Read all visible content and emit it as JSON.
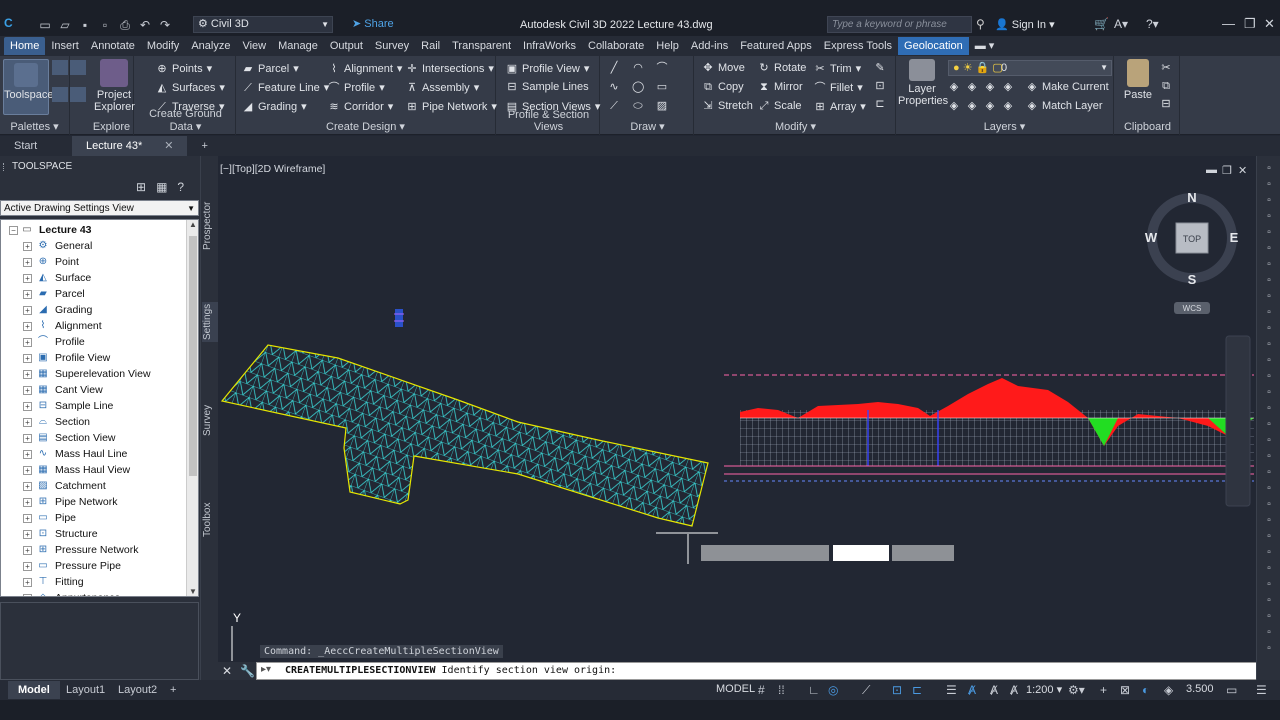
{
  "app": {
    "logo": "C",
    "workspace": "Civil 3D",
    "share_label": "Share",
    "title": "Autodesk Civil 3D 2022    Lecture 43.dwg",
    "search_placeholder": "Type a keyword or phrase",
    "sign_in": "Sign In"
  },
  "ribbon_tabs": [
    "Home",
    "Insert",
    "Annotate",
    "Modify",
    "Analyze",
    "View",
    "Manage",
    "Output",
    "Survey",
    "Rail",
    "Transparent",
    "InfraWorks",
    "Collaborate",
    "Help",
    "Add-ins",
    "Featured Apps",
    "Express Tools",
    "Geolocation"
  ],
  "ribbon": {
    "palettes": {
      "toolspace": "Toolspace",
      "title": "Palettes"
    },
    "explore": {
      "project_explorer": "Project Explorer",
      "title": "Explore"
    },
    "ground": {
      "points": "Points",
      "surfaces": "Surfaces",
      "traverse": "Traverse",
      "title": "Create Ground Data"
    },
    "design": {
      "parcel": "Parcel",
      "feature_line": "Feature Line",
      "grading": "Grading",
      "alignment": "Alignment",
      "profile": "Profile",
      "corridor": "Corridor",
      "intersections": "Intersections",
      "assembly": "Assembly",
      "pipe_network": "Pipe Network",
      "title": "Create Design"
    },
    "profile_section": {
      "profile_view": "Profile View",
      "sample_lines": "Sample Lines",
      "section_views": "Section Views",
      "title": "Profile & Section Views"
    },
    "draw": {
      "title": "Draw"
    },
    "modify": {
      "move": "Move",
      "rotate": "Rotate",
      "trim": "Trim",
      "copy": "Copy",
      "mirror": "Mirror",
      "fillet": "Fillet",
      "stretch": "Stretch",
      "scale": "Scale",
      "array": "Array",
      "title": "Modify"
    },
    "layers": {
      "layer_properties": "Layer Properties",
      "current_layer": "0",
      "make_current": "Make Current",
      "match_layer": "Match Layer",
      "title": "Layers"
    },
    "clipboard": {
      "paste": "Paste",
      "title": "Clipboard"
    }
  },
  "doc_tabs": {
    "start": "Start",
    "active": "Lecture 43*"
  },
  "toolspace": {
    "header": "TOOLSPACE",
    "view_select": "Active Drawing Settings View",
    "root": "Lecture 43",
    "items": [
      {
        "label": "General",
        "icon": "⚙"
      },
      {
        "label": "Point",
        "icon": "⊕"
      },
      {
        "label": "Surface",
        "icon": "◭"
      },
      {
        "label": "Parcel",
        "icon": "▰"
      },
      {
        "label": "Grading",
        "icon": "◢"
      },
      {
        "label": "Alignment",
        "icon": "⌇"
      },
      {
        "label": "Profile",
        "icon": "⌒"
      },
      {
        "label": "Profile View",
        "icon": "▣"
      },
      {
        "label": "Superelevation View",
        "icon": "▦"
      },
      {
        "label": "Cant View",
        "icon": "▦"
      },
      {
        "label": "Sample Line",
        "icon": "⊟"
      },
      {
        "label": "Section",
        "icon": "⌓"
      },
      {
        "label": "Section View",
        "icon": "▤"
      },
      {
        "label": "Mass Haul Line",
        "icon": "∿"
      },
      {
        "label": "Mass Haul View",
        "icon": "▦"
      },
      {
        "label": "Catchment",
        "icon": "▨"
      },
      {
        "label": "Pipe Network",
        "icon": "⊞"
      },
      {
        "label": "Pipe",
        "icon": "▭"
      },
      {
        "label": "Structure",
        "icon": "⊡"
      },
      {
        "label": "Pressure Network",
        "icon": "⊞"
      },
      {
        "label": "Pressure Pipe",
        "icon": "▭"
      },
      {
        "label": "Fitting",
        "icon": "⊤"
      },
      {
        "label": "Appurtenance",
        "icon": "◇"
      }
    ],
    "side_tabs": [
      "Prospector",
      "Settings",
      "Survey",
      "Toolbox"
    ]
  },
  "viewport": {
    "label": "[−][Top][2D Wireframe]",
    "compass": {
      "n": "N",
      "s": "S",
      "e": "E",
      "w": "W",
      "top": "TOP",
      "wcs": "WCS"
    },
    "ucs_label": "Y"
  },
  "command": {
    "history": "Command: _AeccCreateMultipleSectionView",
    "prompt_cmd": "CREATEMULTIPLESECTIONVIEW",
    "prompt_text": " Identify section view origin:"
  },
  "status": {
    "layouts": [
      "Model",
      "Layout1",
      "Layout2"
    ],
    "model": "MODEL",
    "scale": "1:200",
    "elevation": "3.500"
  },
  "colors": {
    "accent": "#2f6db5",
    "surface_mesh": "#3ad6d6",
    "surface_border": "#e6e600",
    "cut_fill": "#ff1a1a",
    "fill_green": "#22dd22"
  }
}
